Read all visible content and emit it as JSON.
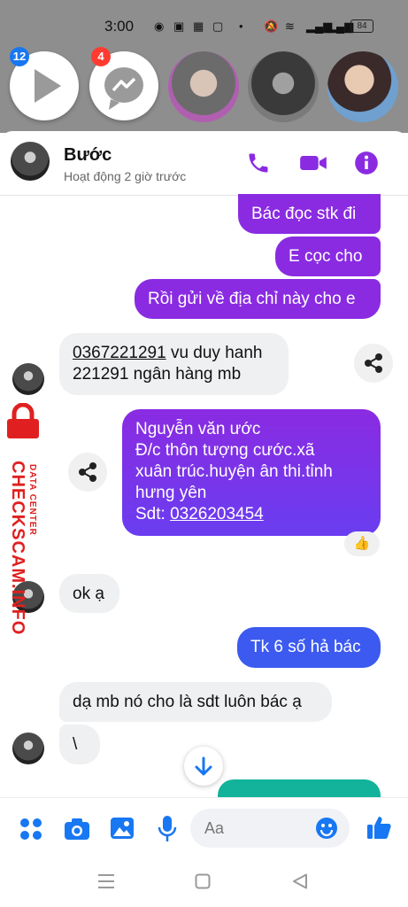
{
  "status_bar": {
    "time": "3:00",
    "battery": "84"
  },
  "chat_heads": {
    "badge_1": "12",
    "badge_2": "4"
  },
  "header": {
    "name": "Bước",
    "status": "Hoạt động 2 giờ trước"
  },
  "messages": {
    "m1": "Bác đọc stk đi",
    "m2": "E cọc cho",
    "m3": "Rồi gửi về địa chỉ này cho e",
    "m4_num": "0367221291",
    "m4_rest": " vu duy hanh",
    "m4_line2": "221291 ngân hàng mb",
    "m5_l1": "Nguyễn văn ước",
    "m5_l2": "Đ/c thôn tượng cước.xã",
    "m5_l3": "xuân trúc.huyện ân thi.tỉnh",
    "m5_l4": "hưng yên",
    "m5_sdt": "Sdt: ",
    "m5_phone": "0326203454",
    "m6": "ok ạ",
    "m7": "Tk 6 số hả bác",
    "m8": "dạ mb nó cho là sdt luôn bác ạ",
    "m9": "\\",
    "reaction": "👍"
  },
  "composer": {
    "placeholder": "Aa"
  },
  "watermark": {
    "brand": "CHECKSCAM.INFO",
    "sub": "DATA CENTER"
  },
  "colors": {
    "accent": "#8a2be2",
    "outgoing_blue": "#3c5af0",
    "messenger_blue": "#1877f2",
    "badge_red": "#ff3b30"
  }
}
